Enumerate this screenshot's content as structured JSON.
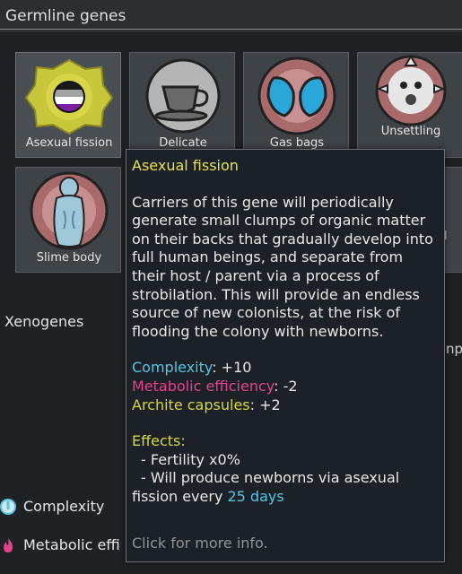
{
  "section": {
    "title": "Germline genes"
  },
  "genes": [
    {
      "label": "Asexual fission",
      "icon": "asexual-fission-icon"
    },
    {
      "label": "Delicate",
      "icon": "teacup-icon"
    },
    {
      "label": "Gas bags",
      "icon": "gas-bags-icon"
    },
    {
      "label": "Unsettling",
      "icon": "unsettling-face-icon"
    },
    {
      "label": "Slime body",
      "icon": "slime-body-icon"
    }
  ],
  "xenogenes_label": "Xenogenes",
  "stats": [
    {
      "label": "Complexity",
      "icon": "complexity-icon"
    },
    {
      "label": "Metabolic effi",
      "icon": "metabolic-flame-icon"
    }
  ],
  "partial_right": {
    "text1": "npl",
    "text2": "l"
  },
  "tooltip": {
    "title": "Asexual fission",
    "description": "Carriers of this gene will periodically generate small clumps of organic matter on their backs that gradually develop into full human beings, and separate from their host / parent via a process of strobilation. This will provide an endless source of new colonists, at the risk of flooding the colony with newborns.",
    "complexity_label": "Complexity",
    "complexity_value": ": +10",
    "metabolic_label": "Metabolic efficiency",
    "metabolic_value": ": -2",
    "archite_label": "Archite capsules",
    "archite_value": ": +2",
    "effects_label": "Effects:",
    "effect_fertility": "- Fertility x0%",
    "effect_newborns": "- Will produce newborns via asexual",
    "effect_newborns_cont": "fission every ",
    "effect_interval": "25 days",
    "footer": "Click for more info."
  },
  "colors": {
    "title_yellow": "#e8e24a",
    "complexity_blue": "#52c6e6",
    "metabolic_pink": "#e6418f",
    "archite_yellow": "#d8d63c"
  }
}
